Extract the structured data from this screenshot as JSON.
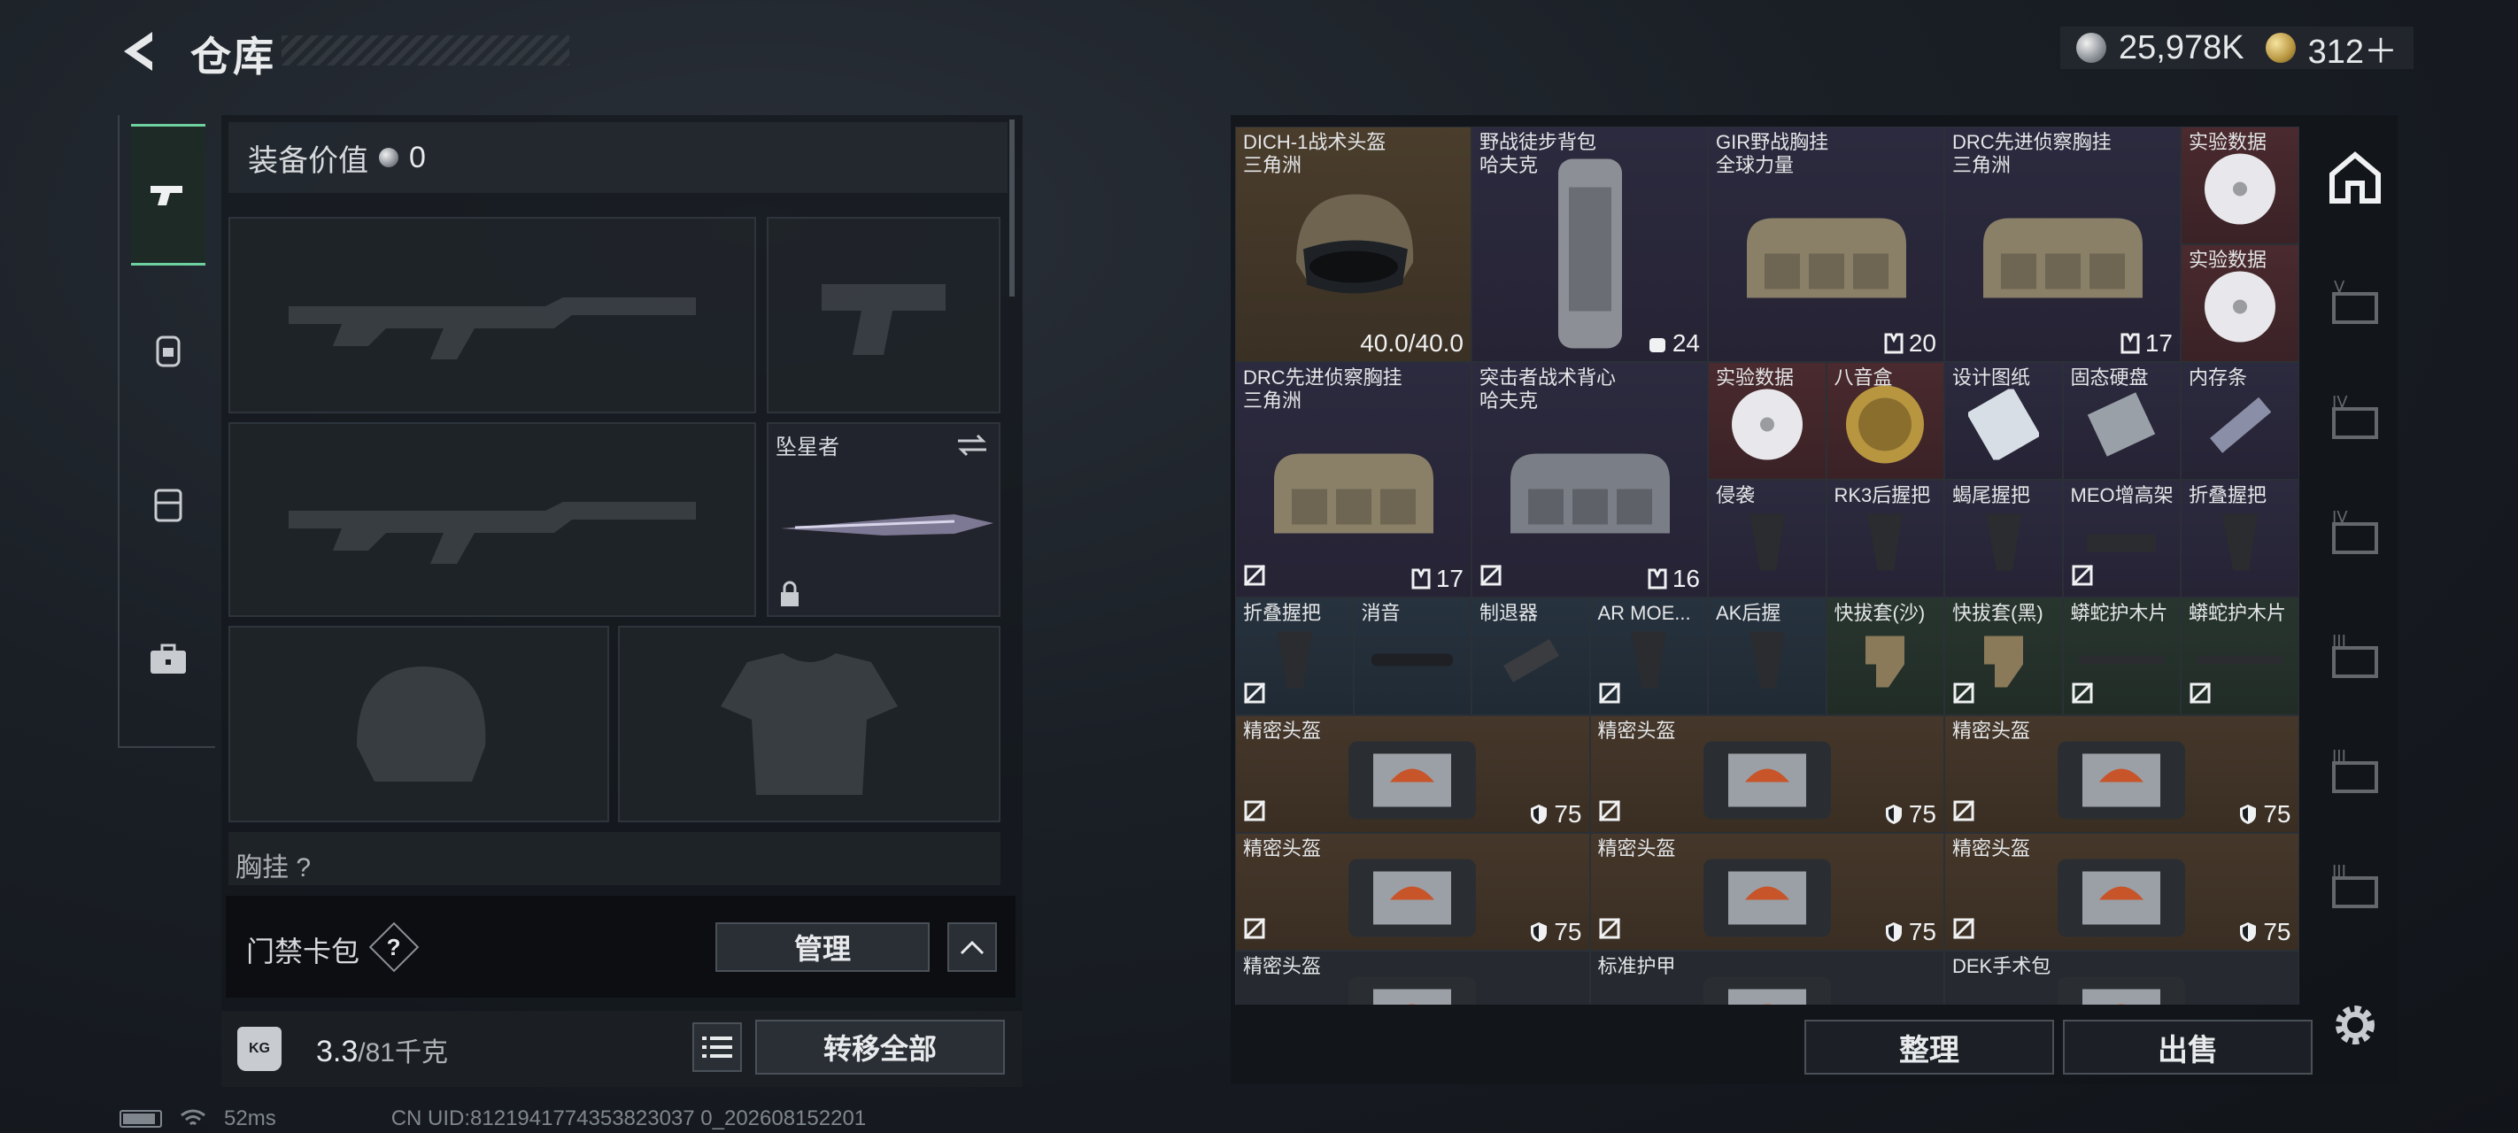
{
  "header": {
    "title": "仓库",
    "currency_silver": "25,978K",
    "currency_gold": "312＋"
  },
  "left_tabs": [
    {
      "name": "tab-weapons",
      "icon": "pistol-icon",
      "active": true
    },
    {
      "name": "tab-equipment",
      "icon": "backpack-icon",
      "active": false
    },
    {
      "name": "tab-rig",
      "icon": "vest-icon",
      "active": false
    },
    {
      "name": "tab-case",
      "icon": "briefcase-icon",
      "active": false
    }
  ],
  "equipment": {
    "value_label": "装备价值",
    "value": "0",
    "melee_slot_label": "坠星者",
    "chest_label": "胸挂 ?",
    "keycard_label": "门禁卡包",
    "keycard_help": "?",
    "manage_label": "管理",
    "weight_icon": "KG",
    "weight_current": "3.3",
    "weight_max": "/81千克",
    "transfer_all_label": "转移全部"
  },
  "status_bar": {
    "ping": "52ms",
    "uid": "CN UID:8121941774353823037 0_202608152201"
  },
  "stash": {
    "items": [
      {
        "name": "DICH-1战术头盔",
        "sub": "三角洲",
        "value": "40.0/40.0"
      },
      {
        "name": "野战徒步背包",
        "sub": "哈夫克",
        "value": "24"
      },
      {
        "name": "GIR野战胸挂",
        "sub": "全球力量",
        "value": "20"
      },
      {
        "name": "DRC先进侦察胸挂",
        "sub": "三角洲",
        "value": "17"
      },
      {
        "name": "实验数据",
        "sub": "",
        "value": ""
      },
      {
        "name": "实验数据",
        "sub": "",
        "value": ""
      },
      {
        "name": "DRC先进侦察胸挂",
        "sub": "三角洲",
        "value": "17"
      },
      {
        "name": "突击者战术背心",
        "sub": "哈夫克",
        "value": "16"
      },
      {
        "name": "实验数据",
        "sub": "",
        "value": ""
      },
      {
        "name": "八音盒",
        "sub": "",
        "value": ""
      },
      {
        "name": "设计图纸",
        "sub": "",
        "value": ""
      },
      {
        "name": "固态硬盘",
        "sub": "",
        "value": ""
      },
      {
        "name": "内存条",
        "sub": "",
        "value": ""
      },
      {
        "name": "侵袭",
        "sub": "",
        "value": ""
      },
      {
        "name": "RK3后握把",
        "sub": "",
        "value": ""
      },
      {
        "name": "蝎尾握把",
        "sub": "",
        "value": ""
      },
      {
        "name": "MEO增高架",
        "sub": "",
        "value": ""
      },
      {
        "name": "折叠握把",
        "sub": "",
        "value": ""
      },
      {
        "name": "折叠握把",
        "sub": "",
        "value": ""
      },
      {
        "name": "消音",
        "sub": "",
        "value": ""
      },
      {
        "name": "制退器",
        "sub": "",
        "value": ""
      },
      {
        "name": "AR MOE...",
        "sub": "",
        "value": ""
      },
      {
        "name": "AK后握",
        "sub": "",
        "value": ""
      },
      {
        "name": "快拔套(沙)",
        "sub": "",
        "value": ""
      },
      {
        "name": "快拔套(黑)",
        "sub": "",
        "value": ""
      },
      {
        "name": "蟒蛇护木片",
        "sub": "",
        "value": ""
      },
      {
        "name": "蟒蛇护木片",
        "sub": "",
        "value": ""
      },
      {
        "name": "精密头盔",
        "sub": "",
        "value": "75"
      },
      {
        "name": "精密头盔",
        "sub": "",
        "value": "75"
      },
      {
        "name": "精密头盔",
        "sub": "",
        "value": "75"
      },
      {
        "name": "精密头盔",
        "sub": "",
        "value": "75"
      },
      {
        "name": "精密头盔",
        "sub": "",
        "value": "75"
      },
      {
        "name": "精密头盔",
        "sub": "",
        "value": "75"
      },
      {
        "name": "精密头盔",
        "sub": "",
        "value": ""
      },
      {
        "name": "标准护甲",
        "sub": "",
        "value": ""
      },
      {
        "name": "DEK手术包",
        "sub": "",
        "value": ""
      }
    ],
    "sort_label": "整理",
    "sell_label": "出售"
  },
  "right_rail": [
    {
      "icon": "stash-home-icon",
      "active": true
    },
    {
      "icon": "stash-tier-v-icon",
      "label": "V"
    },
    {
      "icon": "stash-tier-iv-icon",
      "label": "IV"
    },
    {
      "icon": "stash-tier-iv-b-icon",
      "label": "IV"
    },
    {
      "icon": "stash-tier-iii-icon",
      "label": "III"
    },
    {
      "icon": "stash-tier-iii-b-icon",
      "label": "III"
    },
    {
      "icon": "stash-tier-iii-c-icon",
      "label": "III"
    }
  ],
  "colors": {
    "accent_green": "#6fd0a0",
    "panel_dark": "#14181d",
    "rarity_gold": "#4a3d2c",
    "rarity_purple": "#2c2a3e",
    "rarity_red": "#4a2a2e",
    "rarity_blue": "#26323e",
    "rarity_green": "#28352e"
  }
}
